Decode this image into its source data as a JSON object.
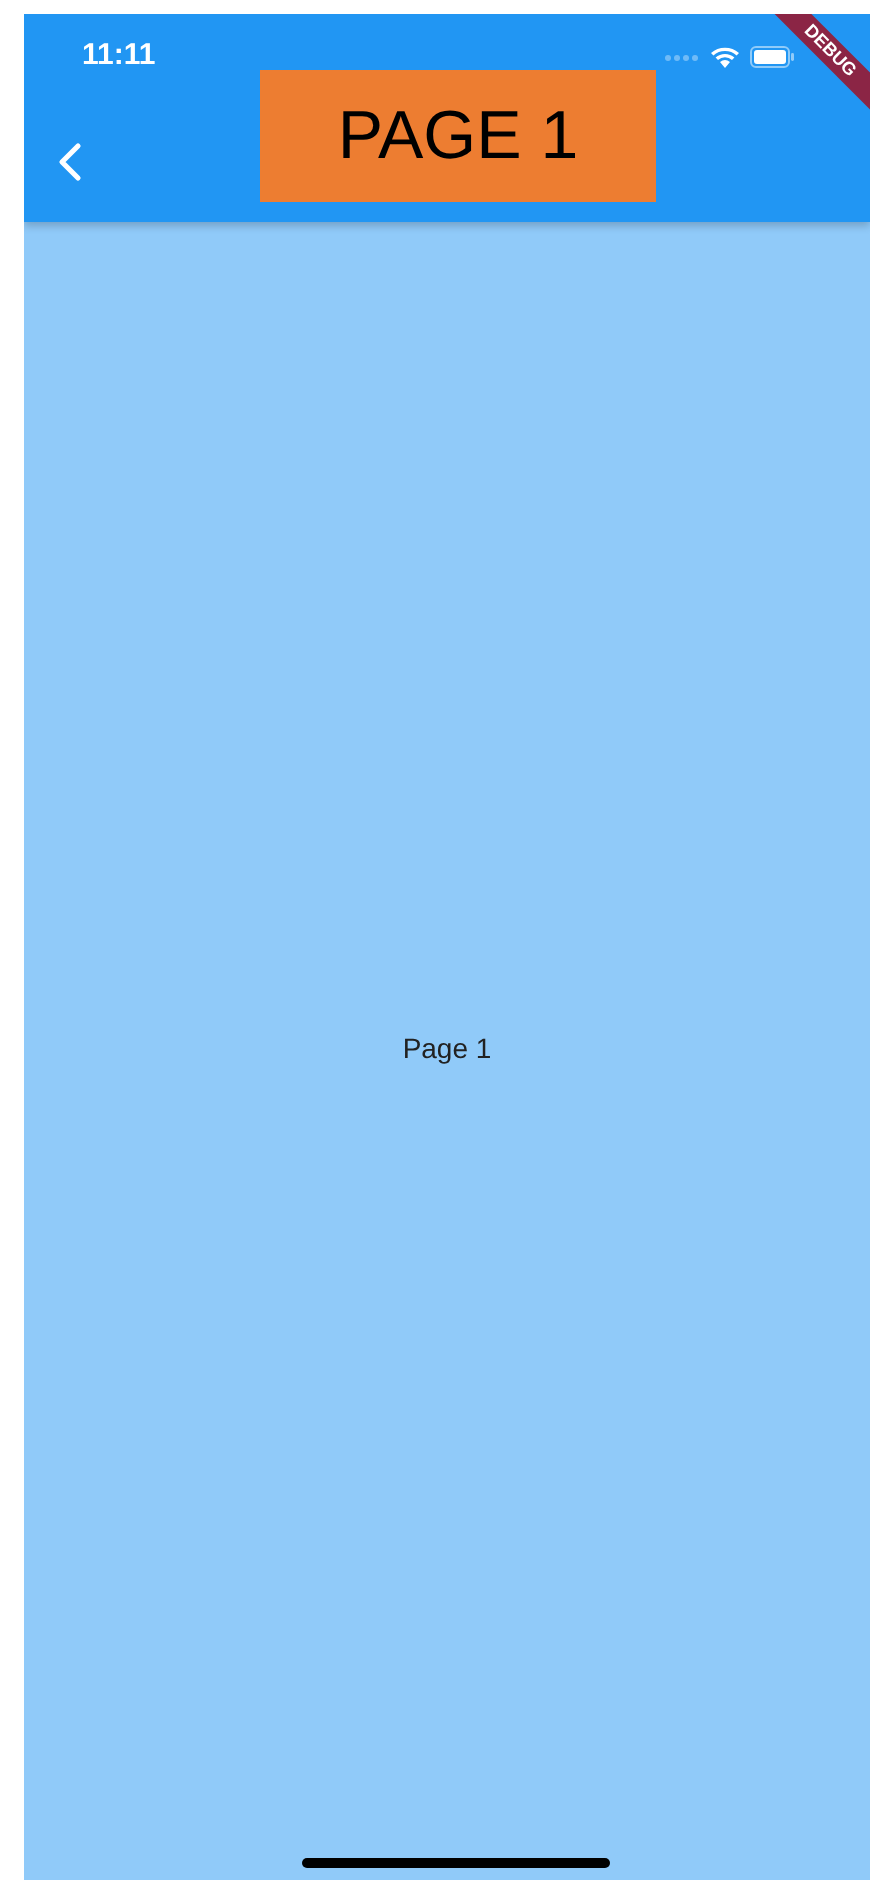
{
  "status_bar": {
    "time": "11:11"
  },
  "app_bar": {
    "title": "PAGE 1"
  },
  "body": {
    "text": "Page 1"
  },
  "debug_banner": {
    "label": "DEBUG"
  }
}
